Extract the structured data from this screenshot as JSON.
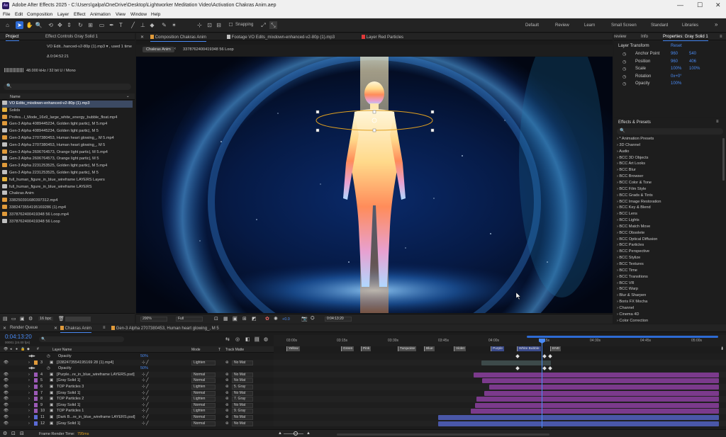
{
  "window": {
    "title": "Adobe After Effects 2025 - C:\\Users\\galpa\\OneDrive\\Desktop\\Lightworker Meditation Video\\Activation Chakras Anim.aep",
    "logo": "Ae",
    "minimize": "—",
    "maximize": "☐",
    "close": "✕"
  },
  "menu": [
    "File",
    "Edit",
    "Composition",
    "Layer",
    "Effect",
    "Animation",
    "View",
    "Window",
    "Help"
  ],
  "toolbar": {
    "snapping": "Snapping",
    "workspaces": [
      "Default",
      "Review",
      "Learn",
      "Small Screen",
      "Standard",
      "Libraries"
    ],
    "more": "»"
  },
  "project_panel": {
    "tab_project": "Project",
    "tab_effect_controls": "Effect Controls Gray Solid 1",
    "selected_item": "VO Edit...hanced-v2-80p (1).mp3 ▾ , used 1 time",
    "duration": "Δ 0:04:52:21",
    "audio_info": "48.000 kHz / 32 bit U / Mono",
    "search_placeholder": "🔍",
    "column_name": "Name",
    "items": [
      {
        "name": "VO Edits_mixdown-enhanced-v2-80p (1).mp3",
        "color": "#c0c0c0",
        "selected": true
      },
      {
        "name": "Solids",
        "color": "#e7b23b"
      },
      {
        "name": "Profes...l_Mode_16x9_large_white_energy_bubble_float.mp4",
        "color": "#e09a3a"
      },
      {
        "name": "Gen-3 Alpha 4089445234, Golden light partic|, M 5.mp4",
        "color": "#e09a3a"
      },
      {
        "name": "Gen-3 Alpha 4089445234, Golden light partic|, M 5",
        "color": "#c0c0c0"
      },
      {
        "name": "Gen-3 Alpha 2707380453, Human heart glowing_, M 5.mp4",
        "color": "#e09a3a"
      },
      {
        "name": "Gen-3 Alpha 2707380453, Human heart glowing_, M 5",
        "color": "#c0c0c0"
      },
      {
        "name": "Gen-3 Alpha 2606764573, Orange light partic|, M 5.mp4",
        "color": "#e09a3a"
      },
      {
        "name": "Gen-3 Alpha 2606764573, Orange light partic|, M 5",
        "color": "#c0c0c0"
      },
      {
        "name": "Gen-3 Alpha 2231253525, Golden light partic|, M 5.mp4",
        "color": "#e09a3a"
      },
      {
        "name": "Gen-3 Alpha 2231253525, Golden light partic|, M 5",
        "color": "#c0c0c0"
      },
      {
        "name": "full_human_figure_in_blue_wireframe LAYERS Layers",
        "color": "#e7b23b"
      },
      {
        "name": "full_human_figure_in_blue_wireframe LAYERS",
        "color": "#c0c0c0"
      },
      {
        "name": "Chakras Anim",
        "color": "#c0c0c0"
      },
      {
        "name": "338250391680397312.mp4",
        "color": "#e09a3a"
      },
      {
        "name": "3382473554195169286 (1).mp4",
        "color": "#e09a3a"
      },
      {
        "name": "3378762400419348 56 Loop.mp4",
        "color": "#e09a3a"
      },
      {
        "name": "3378762400419348 56 Loop",
        "color": "#c0c0c0"
      }
    ],
    "bpc": "16 bpc"
  },
  "comp_panel": {
    "tab_comp": "Composition Chakras Anim",
    "tab_footage": "Footage VO Edits_mixdown-enhanced-v2-80p (1).mp3",
    "tab_layer": "Layer Red Particles",
    "breadcrumb_comp": "Chakras Anim",
    "breadcrumb_item": "3378762400419348 56 Loop",
    "zoom": "200%",
    "resolution": "Full",
    "exposure": "+0.0",
    "timecode": "0:04:13:20"
  },
  "properties_panel": {
    "tab_review": "review",
    "tab_info": "Info",
    "tab_properties": "Properties: Gray Solid 1",
    "section": "Layer Transform",
    "reset": "Reset",
    "props": [
      {
        "label": "Anchor Point",
        "v1": "960",
        "v2": "540"
      },
      {
        "label": "Position",
        "v1": "960",
        "v2": "406"
      },
      {
        "label": "Scale",
        "v1": "100%",
        "v2": "100%"
      },
      {
        "label": "Rotation",
        "v1": "0x+0°",
        "v2": ""
      },
      {
        "label": "Opacity",
        "v1": "100%",
        "v2": ""
      }
    ]
  },
  "effects_panel": {
    "title": "Effects & Presets",
    "search_placeholder": "🔍",
    "items": [
      "* Animation Presets",
      "3D Channel",
      "Audio",
      "BCC 3D Objects",
      "BCC Art Looks",
      "BCC Blur",
      "BCC Browser",
      "BCC Color & Tone",
      "BCC Film Style",
      "BCC Grads & Tints",
      "BCC Image Restoration",
      "BCC Key & Blend",
      "BCC Lens",
      "BCC Lights",
      "BCC Match Move",
      "BCC Obsolete",
      "BCC Optical Diffusion",
      "BCC Particles",
      "BCC Perspective",
      "BCC Stylize",
      "BCC Textures",
      "BCC Time",
      "BCC Transitions",
      "BCC VR",
      "BCC Warp",
      "Blur & Sharpen",
      "Boris FX Mocha",
      "Channel",
      "Cinema 4D",
      "Color Correction"
    ]
  },
  "timeline": {
    "tab_render": "Render Queue",
    "tab_comp": "Chakras Anim",
    "tab_other": "Gen-3 Alpha 2707380453, Human heart glowing_, M 5",
    "timecode": "0:04:13:20",
    "frames": "00001 (24.00 fps)",
    "search_placeholder": "🔍",
    "col_layer": "Layer Name",
    "col_mode": "Mode",
    "col_t": "T",
    "col_matte": "Track Matte",
    "ruler": [
      "03:00s",
      "03:15s",
      "03:30s",
      "03:45s",
      "04:00s",
      "04:15s",
      "04:30s",
      "04:45s",
      "05:00s"
    ],
    "markers": [
      "Yellow",
      "Green",
      "Pink",
      "Turquoise",
      "Blue",
      "Violet",
      "Purple",
      "White Bubble",
      "END"
    ],
    "rows": [
      {
        "num": "",
        "name": "Opacity",
        "mode": "",
        "matte": "",
        "sub": true,
        "val": "50%"
      },
      {
        "num": "3",
        "name": "[3382473554195169 28 (1).mp4]",
        "mode": "Lighten",
        "matte": "No Mat",
        "color": "#e09a3a"
      },
      {
        "num": "",
        "name": "Opacity",
        "mode": "",
        "matte": "",
        "sub": true,
        "val": "50%"
      },
      {
        "num": "4",
        "name": "[Purple...re_in_blue_wireframe LAYERS.psd]",
        "mode": "Normal",
        "matte": "No Mat",
        "color": "#9b59b6"
      },
      {
        "num": "5",
        "name": "[Gray Solid 1]",
        "mode": "Normal",
        "matte": "No Mat",
        "color": "#9b59b6"
      },
      {
        "num": "6",
        "name": "TOP Particles 3",
        "mode": "Lighten",
        "matte": "5. Gray",
        "color": "#9b59b6"
      },
      {
        "num": "7",
        "name": "[Gray Solid 1]",
        "mode": "Normal",
        "matte": "No Mat",
        "color": "#9b59b6"
      },
      {
        "num": "8",
        "name": "TOP Particles 2",
        "mode": "Lighten",
        "matte": "7. Gray",
        "color": "#9b59b6"
      },
      {
        "num": "9",
        "name": "[Gray Solid 1]",
        "mode": "Normal",
        "matte": "No Mat",
        "color": "#9b59b6"
      },
      {
        "num": "10",
        "name": "TOP Particles 1",
        "mode": "Lighten",
        "matte": "9. Gray",
        "color": "#9b59b6"
      },
      {
        "num": "11",
        "name": "[Dark B...re_in_blue_wireframe LAYERS.psd]",
        "mode": "Normal",
        "matte": "No Mat",
        "color": "#5b6bd6"
      },
      {
        "num": "12",
        "name": "[Gray Solid 1]",
        "mode": "Normal",
        "matte": "No Mat",
        "color": "#5b6bd6"
      }
    ],
    "render_time_label": "Frame Render Time:",
    "render_time": "795ms"
  },
  "colors": {
    "accent": "#2d6bd4",
    "timecode": "#4a8bf5",
    "purple_bar": "#7b3a8c",
    "blue_bar": "#4a57a8",
    "gray_bar": "#3d4a4a"
  }
}
